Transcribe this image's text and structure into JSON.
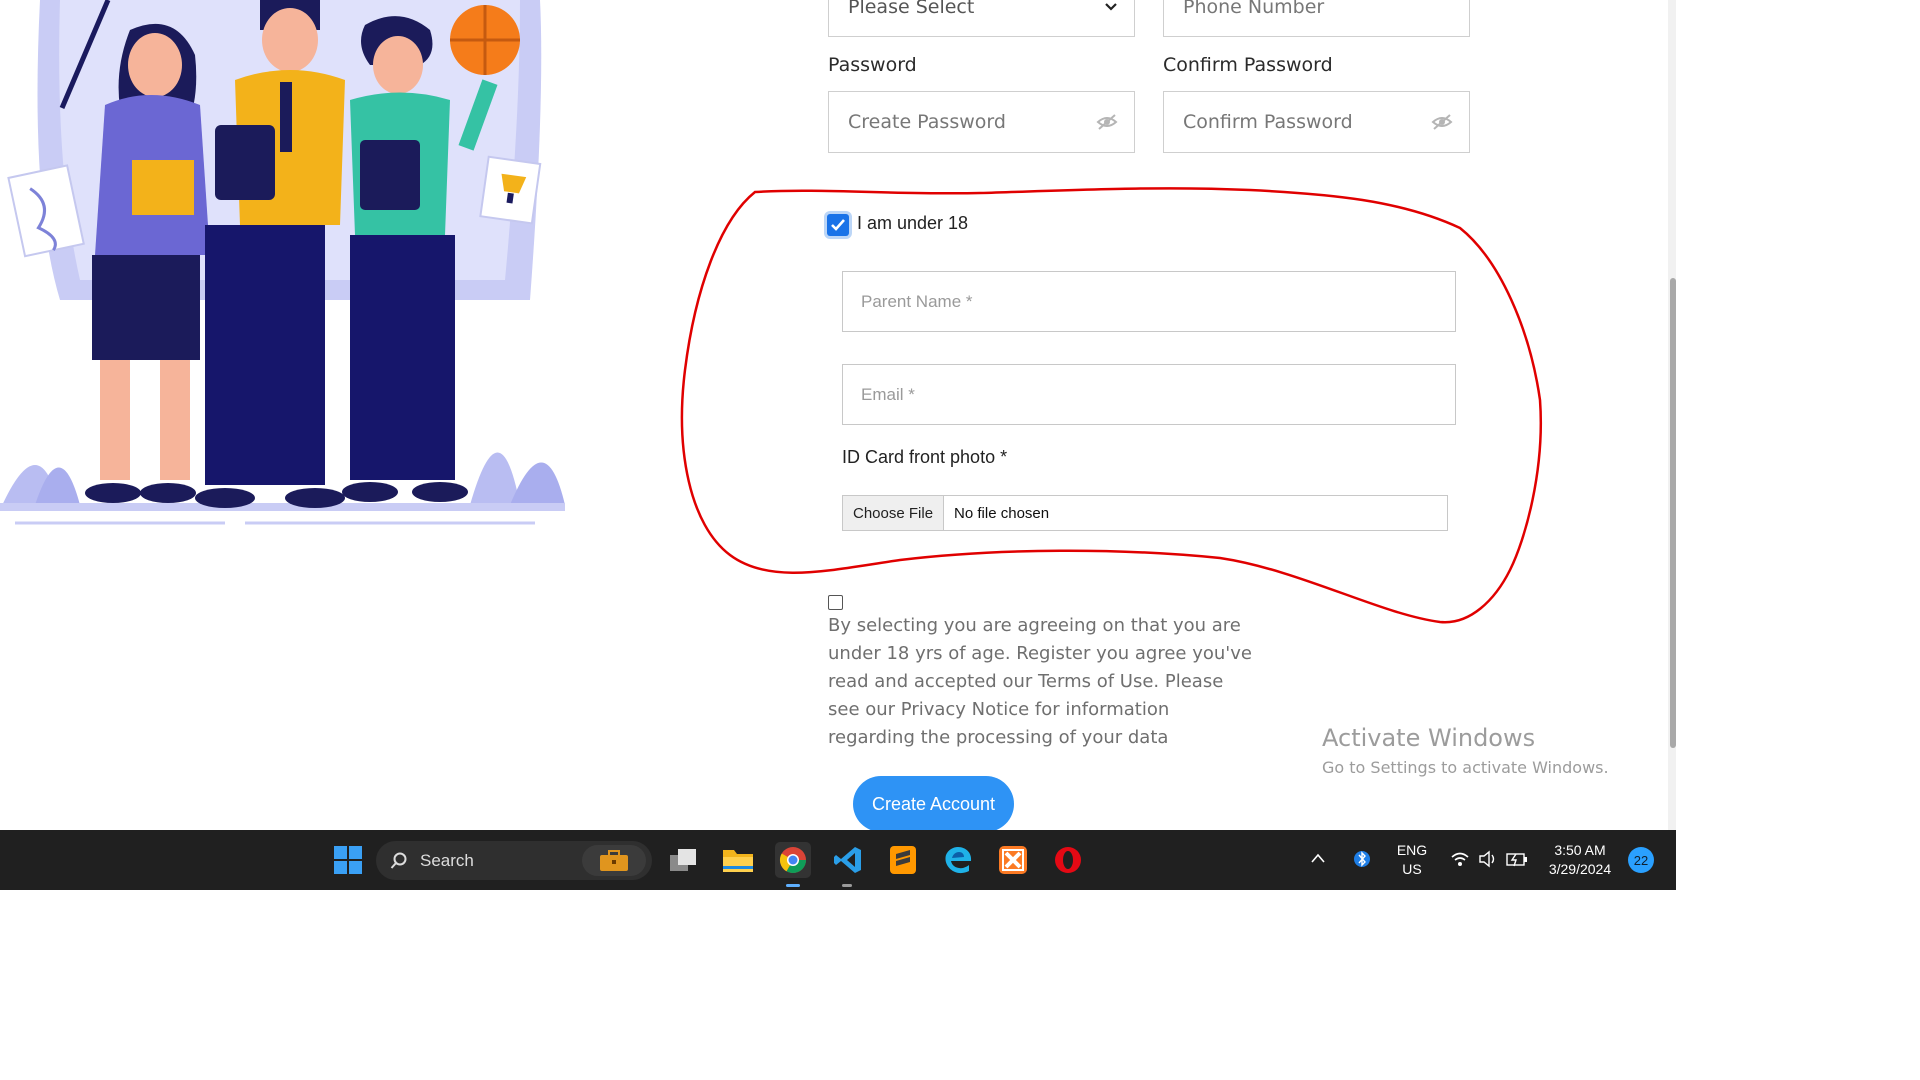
{
  "form": {
    "select_placeholder": "Please Select",
    "phone_placeholder": "Phone Number",
    "password_label": "Password",
    "confirm_password_label": "Confirm Password",
    "password_placeholder": "Create Password",
    "confirm_password_placeholder": "Confirm Password",
    "under18_label": "I am under 18",
    "under18_checked": true,
    "parent_name_placeholder": "Parent Name *",
    "email_placeholder": "Email *",
    "id_card_label": "ID Card front photo *",
    "choose_file_label": "Choose File",
    "file_status": "No file chosen",
    "agree_checked": false,
    "agree_text": "By selecting you are agreeing on that you are under 18 yrs of age. Register you agree you've read and accepted our Terms of Use. Please see our Privacy Notice for information regarding the processing of your data",
    "submit_label": "Create Account"
  },
  "watermark": {
    "title": "Activate Windows",
    "subtitle": "Go to Settings to activate Windows."
  },
  "taskbar": {
    "search_label": "Search",
    "apps": [
      "start-icon",
      "search-icon",
      "work-briefcase-icon",
      "task-view-icon",
      "file-explorer-icon",
      "chrome-icon",
      "vscode-icon",
      "sublime-text-icon",
      "edge-icon",
      "xampp-icon",
      "opera-icon"
    ],
    "tray": {
      "language": "ENG",
      "region": "US",
      "time": "3:50 AM",
      "date": "3/29/2024",
      "notifications": "22"
    }
  },
  "colors": {
    "accent": "#2e93f5",
    "highlight_circle": "#e00000",
    "taskbar": "#202020"
  }
}
